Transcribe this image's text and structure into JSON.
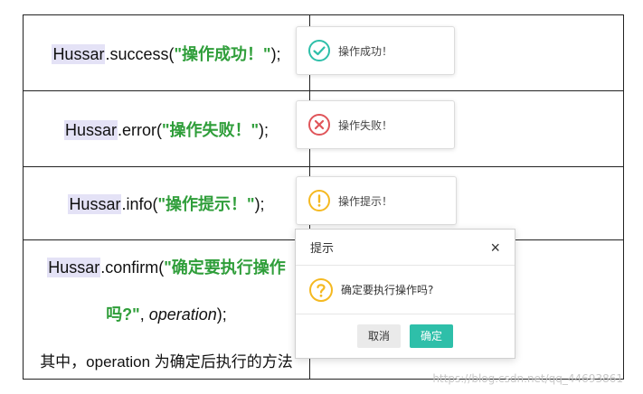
{
  "rows": {
    "success": {
      "code_obj": "Hussar",
      "code_method": ".success(",
      "code_string": "\"操作成功！\"",
      "code_end": ");",
      "toast_text": "操作成功！"
    },
    "error": {
      "code_obj": "Hussar",
      "code_method": ".error(",
      "code_string": "\"操作失败！\"",
      "code_end": ");",
      "toast_text": "操作失败！"
    },
    "info": {
      "code_obj": "Hussar",
      "code_method": ".info(",
      "code_string": "\"操作提示！\"",
      "code_end": ");",
      "toast_text": "操作提示！"
    },
    "confirm": {
      "code_obj": "Hussar",
      "code_method": ".confirm(",
      "code_string_1": "\"确定要执行操作",
      "code_string_2": "吗?\"",
      "code_sep": ", ",
      "code_param": "operation",
      "code_end": ");",
      "note": "其中，operation 为确定后执行的方法",
      "dialog": {
        "title": "提示",
        "close": "×",
        "message": "确定要执行操作吗?",
        "cancel_label": "取消",
        "ok_label": "确定"
      }
    }
  },
  "icons": {
    "success": "check-circle-icon",
    "error": "x-circle-icon",
    "info": "exclamation-circle-icon",
    "confirm": "question-circle-icon"
  },
  "colors": {
    "success": "#2ebfa9",
    "error": "#e0555a",
    "warning": "#f5b921",
    "code_string": "#2f9e3a",
    "highlight": "#e4e2f6",
    "ok_button": "#2ebfa9"
  },
  "watermark": "https://blog.csdn.net/qq_44693861"
}
